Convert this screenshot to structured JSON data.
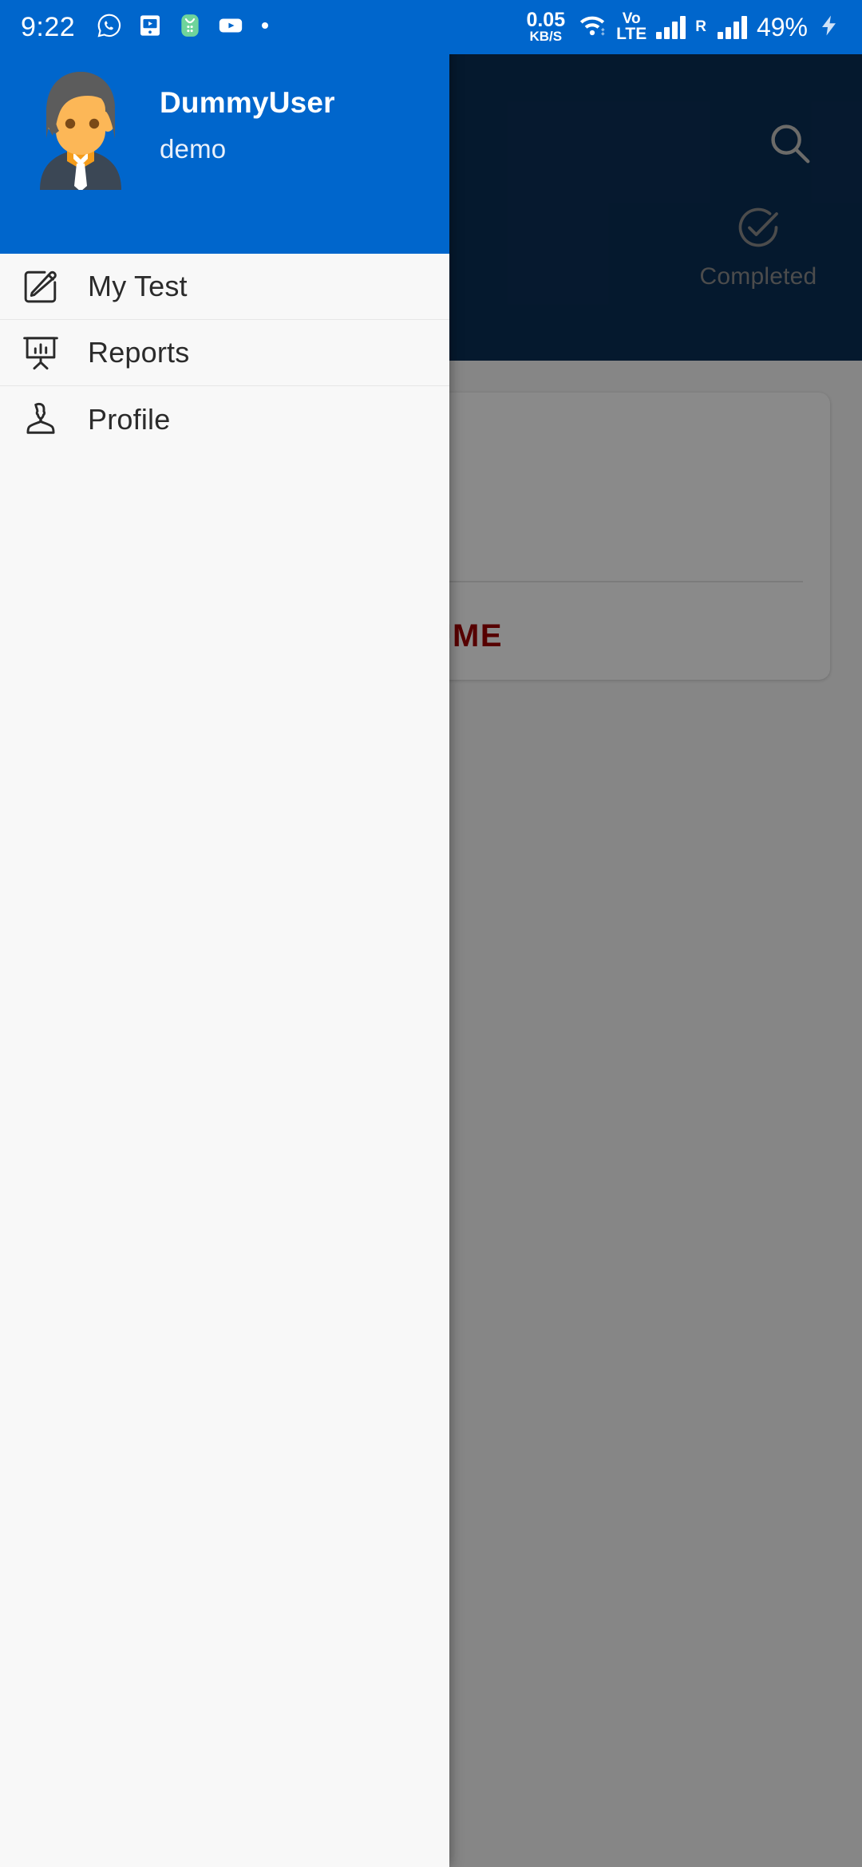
{
  "status_bar": {
    "time": "9:22",
    "left_icons": [
      "whatsapp-icon",
      "app-screen-icon",
      "green-app-icon",
      "youtube-icon",
      "dot-icon"
    ],
    "net_speed_value": "0.05",
    "net_speed_unit": "KB/S",
    "wifi": "wifi-icon",
    "volte_line1": "Vo",
    "volte_line2": "LTE",
    "signal_1": "signal-bars-icon",
    "roaming": "R",
    "signal_2": "signal-bars-icon",
    "battery_percent": "49%",
    "charging": "charging-bolt-icon"
  },
  "background_app": {
    "appbar": {
      "search_icon": "search-icon",
      "bar_color": "#0b2f56"
    },
    "tabs": [
      {
        "label": "Completed",
        "icon": "check-circle-icon"
      }
    ],
    "card": {
      "action_label": "RESUME",
      "action_color": "#a00000"
    }
  },
  "drawer": {
    "header": {
      "avatar": "user-avatar-illustration",
      "username": "DummyUser",
      "subtitle": "demo",
      "background_color": "#0066cc"
    },
    "items": [
      {
        "label": "My Test",
        "icon": "edit-square-icon"
      },
      {
        "label": "Reports",
        "icon": "presentation-chart-icon"
      },
      {
        "label": "Profile",
        "icon": "person-icon"
      }
    ]
  }
}
